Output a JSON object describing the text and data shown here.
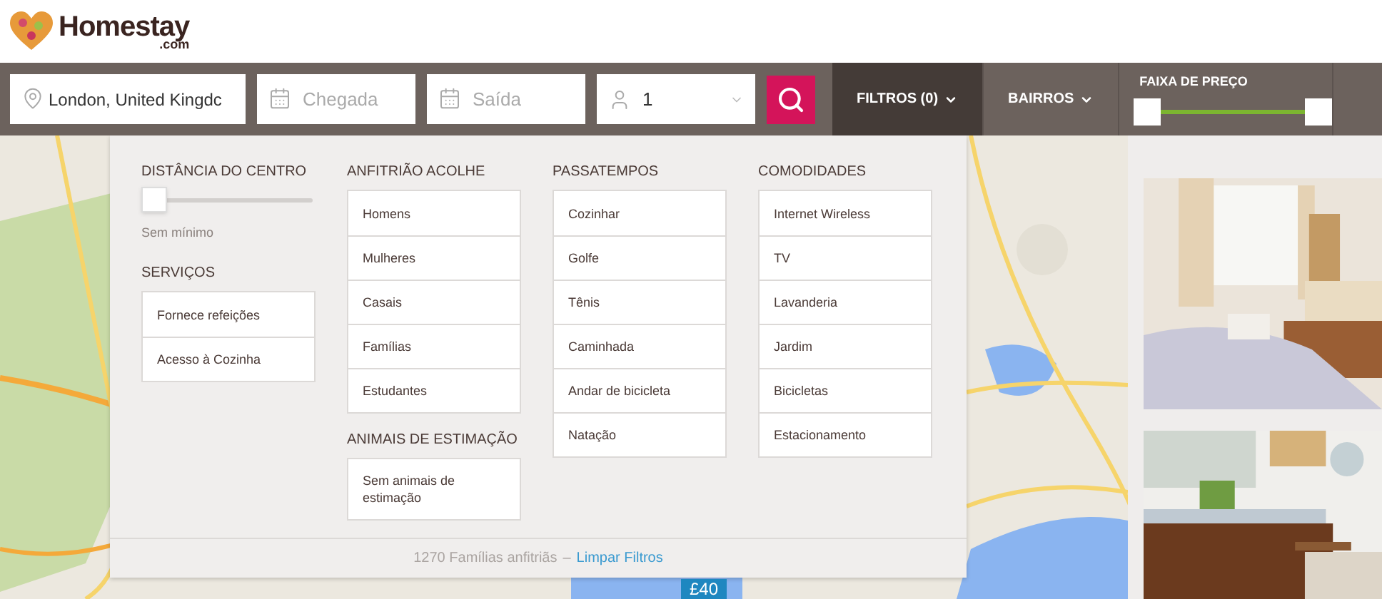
{
  "logo": {
    "name": "Homestay",
    "suffix": ".com"
  },
  "search": {
    "location": {
      "value": "London, United Kingdc"
    },
    "checkin": {
      "placeholder": "Chegada"
    },
    "checkout": {
      "placeholder": "Saída"
    },
    "guests": {
      "value": "1"
    }
  },
  "nav": [
    {
      "label": "FILTROS (0)",
      "selected": true
    },
    {
      "label": "BAIRROS",
      "selected": false
    }
  ],
  "price_range": {
    "title": "FAIXA DE PREÇO",
    "min_handle": {
      "level": 0
    },
    "max_handle": {
      "level": 1
    }
  },
  "filters": {
    "columns": [
      {
        "sections": [
          {
            "kind": "slider",
            "title": "DISTÂNCIA DO CENTRO",
            "level": 0,
            "reading": "Sem mínimo"
          },
          {
            "kind": "list",
            "title": "SERVIÇOS",
            "options": [
              "Fornece refeições",
              "Acesso à Cozinha"
            ]
          }
        ]
      },
      {
        "sections": [
          {
            "kind": "list",
            "title": "ANFITRIÃO ACOLHE",
            "options": [
              "Homens",
              "Mulheres",
              "Casais",
              "Famílias",
              "Estudantes"
            ]
          },
          {
            "kind": "list",
            "title": "ANIMAIS DE ESTIMAÇÃO",
            "options": [
              "Sem animais de estimação"
            ]
          }
        ]
      },
      {
        "sections": [
          {
            "kind": "list",
            "title": "PASSATEMPOS",
            "options": [
              "Cozinhar",
              "Golfe",
              "Tênis",
              "Caminhada",
              "Andar de bicicleta",
              "Natação"
            ]
          }
        ]
      },
      {
        "sections": [
          {
            "kind": "list",
            "title": "COMODIDADES",
            "options": [
              "Internet Wireless",
              "TV",
              "Lavanderia",
              "Jardim",
              "Bicicletas",
              "Estacionamento"
            ]
          }
        ]
      }
    ],
    "footer": {
      "count": "1270 Famílias anfitriãs",
      "separator": "–",
      "link": "Limpar Filtros"
    }
  },
  "map_markers": [
    {
      "label": "£40"
    }
  ]
}
